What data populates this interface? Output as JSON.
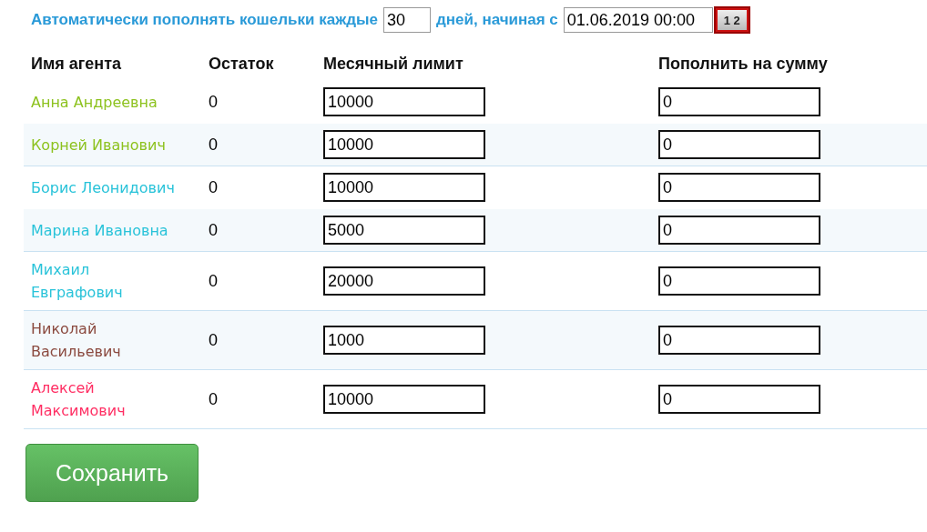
{
  "autofill": {
    "label_before": "Автоматически пополнять кошельки каждые",
    "days": "30",
    "label_middle": "дней, начиная с",
    "start_date": "01.06.2019 00:00",
    "calendar_button": "1 2"
  },
  "table": {
    "columns": [
      "Имя агента",
      "Остаток",
      "Месячный лимит",
      "Пополнить на сумму"
    ],
    "rows": [
      {
        "name": "Анна Андреевна",
        "color": "#8dc21f",
        "balance": "0",
        "limit": "10000",
        "topup": "0"
      },
      {
        "name": "Корней Иванович",
        "color": "#8dc21f",
        "balance": "0",
        "limit": "10000",
        "topup": "0"
      },
      {
        "name": "Борис Леонидович",
        "color": "#29c3d9",
        "balance": "0",
        "limit": "10000",
        "topup": "0"
      },
      {
        "name": "Марина Ивановна",
        "color": "#29c3d9",
        "balance": "0",
        "limit": "5000",
        "topup": "0"
      },
      {
        "name": "Михаил Евграфович",
        "color": "#29c3d9",
        "balance": "0",
        "limit": "20000",
        "topup": "0"
      },
      {
        "name": "Николай Васильевич",
        "color": "#8b4a3f",
        "balance": "0",
        "limit": "1000",
        "topup": "0"
      },
      {
        "name": "Алексей Максимович",
        "color": "#ff2e63",
        "balance": "0",
        "limit": "10000",
        "topup": "0"
      }
    ]
  },
  "save_button": "Сохранить"
}
